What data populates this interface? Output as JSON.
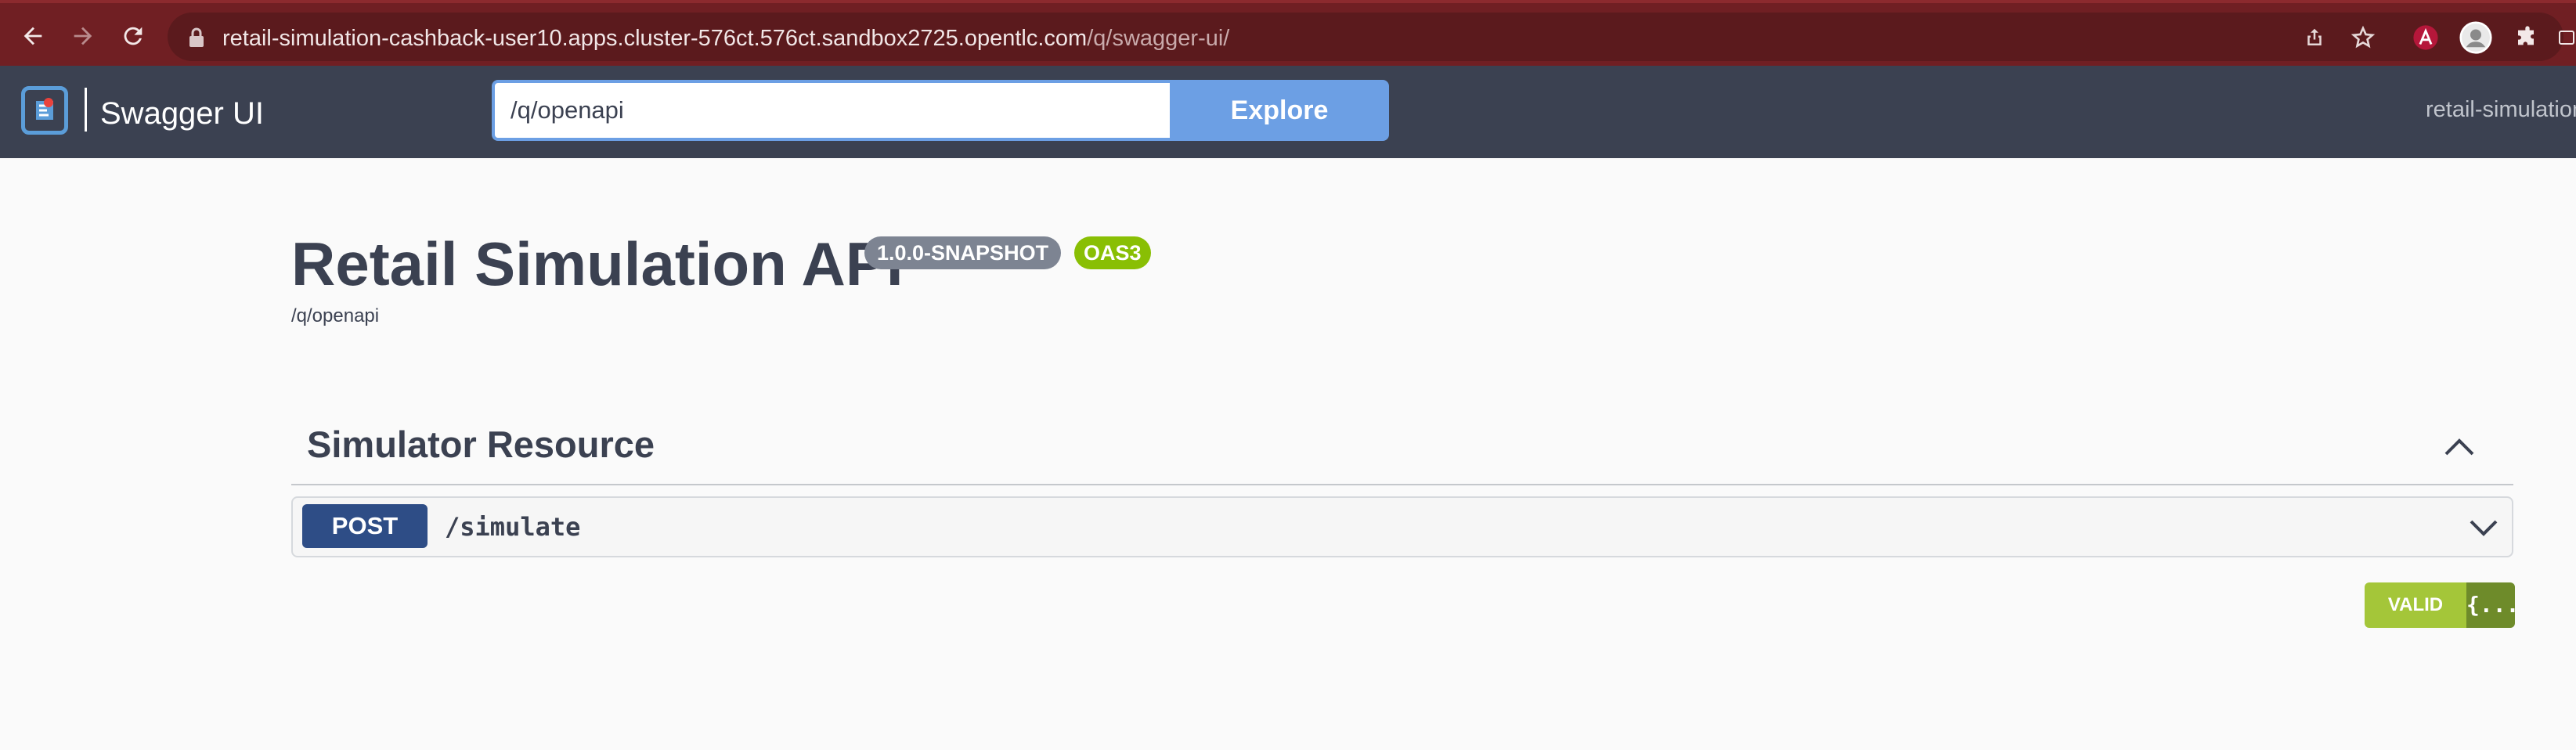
{
  "browser": {
    "url_host": "retail-simulation-cashback-user10.apps.cluster-576ct.576ct.sandbox2725.opentlc.com",
    "url_path": "/q/swagger-ui/",
    "icons": [
      "back-arrow-icon",
      "forward-arrow-icon",
      "reload-icon",
      "lock-icon",
      "share-icon",
      "star-icon",
      "extension-a-icon",
      "profile-icon",
      "puzzle-icon",
      "sidebar-icon"
    ]
  },
  "topbar": {
    "logo_text": "Swagger UI",
    "spec_url_value": "/q/openapi",
    "explore_label": "Explore",
    "right_text": "retail-simulation"
  },
  "info": {
    "title": "Retail Simulation API",
    "version_badge": "1.0.0-SNAPSHOT",
    "oas_badge": "OAS3",
    "spec_link": "/q/openapi"
  },
  "section": {
    "title": "Simulator Resource",
    "operations": [
      {
        "method": "POST",
        "path": "/simulate"
      }
    ]
  },
  "validator": {
    "label": "VALID",
    "icon_text": "{...}"
  },
  "colors": {
    "browser_bar": "#701f23",
    "topbar": "#3b4151",
    "explore": "#6c9fe4",
    "post": "#2e4d86",
    "oas": "#89bf04",
    "version": "#7d8492",
    "valid": "#a4c639"
  }
}
